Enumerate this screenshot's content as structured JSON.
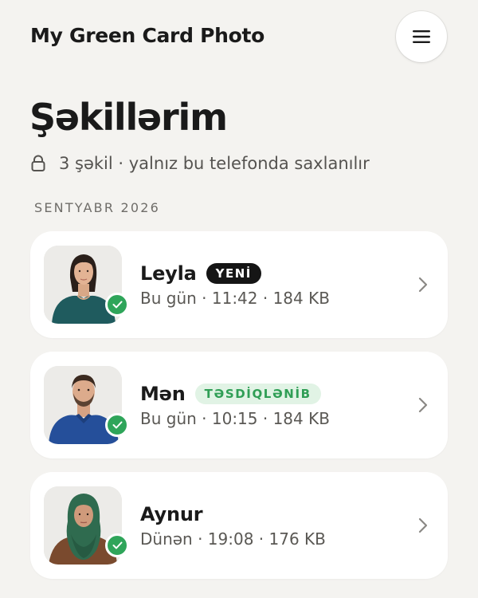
{
  "header": {
    "app_title": "My Green Card Photo",
    "menu_icon": "hamburger-menu-icon"
  },
  "page": {
    "title": "Şəkillərim",
    "subtitle": "3 şəkil · yalnız bu telefonda saxlanılır",
    "lock_icon": "lock-icon"
  },
  "section": {
    "label": "SENTYABR 2026"
  },
  "photos": [
    {
      "name": "Leyla",
      "badge": "YENİ",
      "badge_style": "dark",
      "meta": "Bu gün · 11:42 · 184 KB",
      "verified": true
    },
    {
      "name": "Mən",
      "badge": "TƏSDİQLƏNİB",
      "badge_style": "green",
      "meta": "Bu gün · 10:15 · 184 KB",
      "verified": true
    },
    {
      "name": "Aynur",
      "badge": "",
      "meta": "Dünən · 19:08 · 176 KB",
      "verified": true
    }
  ],
  "colors": {
    "background": "#f4f3f0",
    "card": "#ffffff",
    "accent_green": "#2fa55a",
    "badge_dark": "#151515",
    "badge_green_bg": "#e1f3e5"
  }
}
